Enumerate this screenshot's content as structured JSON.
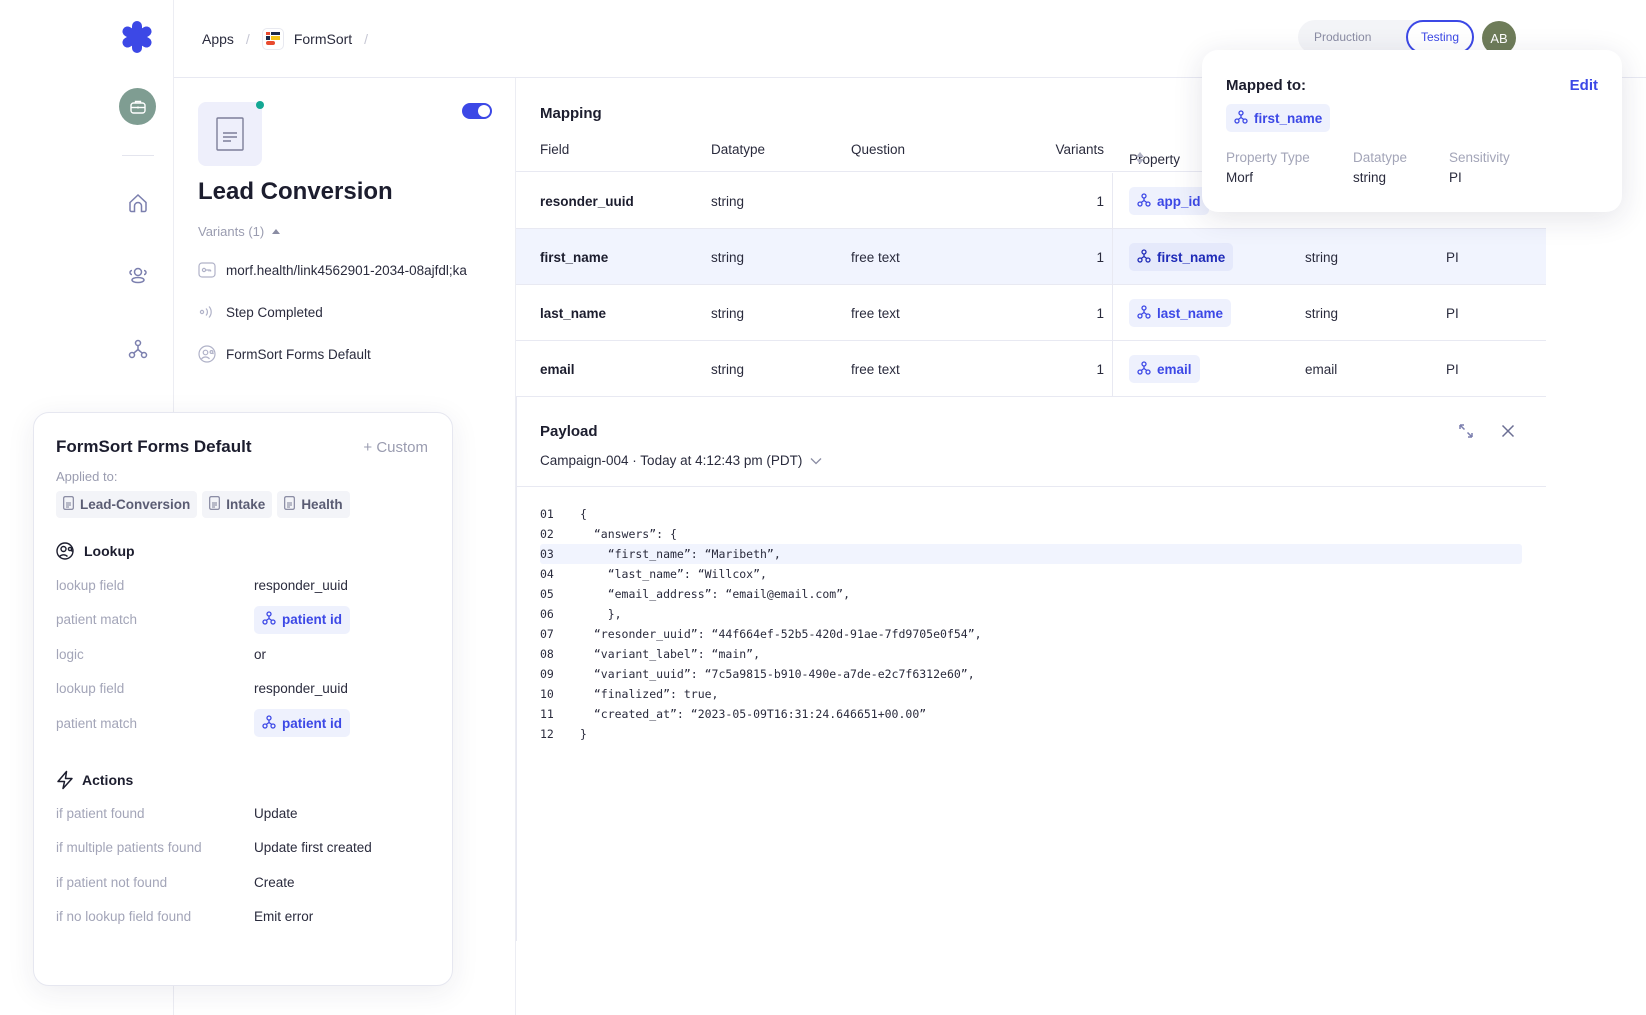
{
  "breadcrumb": {
    "apps": "Apps",
    "app": "FormSort"
  },
  "environment": {
    "options": [
      "Production",
      "Testing"
    ],
    "selected": "Testing"
  },
  "user": {
    "initials": "AB"
  },
  "form": {
    "title": "Lead Conversion",
    "variants_label": "Variants (1)",
    "link": "morf.health/link4562901-2034-08ajfdl;ka",
    "trigger": "Step Completed",
    "ruleset": "FormSort Forms Default",
    "enabled": true
  },
  "ruleset_card": {
    "title": "FormSort Forms Default",
    "custom_label": "+ Custom",
    "applied_label": "Applied to:",
    "applied_to": [
      "Lead-Conversion",
      "Intake",
      "Health"
    ],
    "lookup": {
      "heading": "Lookup",
      "rows": [
        {
          "key": "lookup field",
          "value": "responder_uuid",
          "type": "text"
        },
        {
          "key": "patient match",
          "value": "patient id",
          "type": "tag"
        },
        {
          "key": "logic",
          "value": "or",
          "type": "text"
        },
        {
          "key": "lookup field",
          "value": "responder_uuid",
          "type": "text"
        },
        {
          "key": "patient match",
          "value": "patient id",
          "type": "tag"
        }
      ]
    },
    "actions": {
      "heading": "Actions",
      "rows": [
        {
          "key": "if patient found",
          "value": "Update"
        },
        {
          "key": "if multiple patients found",
          "value": "Update first created"
        },
        {
          "key": "if patient not found",
          "value": "Create"
        },
        {
          "key": "if no lookup field found",
          "value": "Emit error"
        }
      ]
    }
  },
  "mapping": {
    "title": "Mapping",
    "columns": [
      "Field",
      "Datatype",
      "Question",
      "Variants",
      "Property"
    ],
    "rows": [
      {
        "field": "resonder_uuid",
        "datatype": "string",
        "question": "",
        "variants": "1",
        "property": "app_id",
        "prop_datatype": "",
        "sensitivity": ""
      },
      {
        "field": "first_name",
        "datatype": "string",
        "question": "free text",
        "variants": "1",
        "property": "first_name",
        "prop_datatype": "string",
        "sensitivity": "PI",
        "selected": true
      },
      {
        "field": "last_name",
        "datatype": "string",
        "question": "free text",
        "variants": "1",
        "property": "last_name",
        "prop_datatype": "string",
        "sensitivity": "PI"
      },
      {
        "field": "email",
        "datatype": "string",
        "question": "free text",
        "variants": "1",
        "property": "email",
        "prop_datatype": "email",
        "sensitivity": "PI"
      }
    ]
  },
  "popover": {
    "title": "Mapped to:",
    "edit_label": "Edit",
    "property": "first_name",
    "columns": [
      {
        "label": "Property Type",
        "value": "Morf"
      },
      {
        "label": "Datatype",
        "value": "string"
      },
      {
        "label": "Sensitivity",
        "value": "PI"
      }
    ]
  },
  "payload": {
    "title": "Payload",
    "event": "Campaign-004 · Today at 4:12:43 pm (PDT)",
    "highlighted_line": "03",
    "lines": [
      {
        "n": "01",
        "text": "{"
      },
      {
        "n": "02",
        "text": "  “answers”: {"
      },
      {
        "n": "03",
        "text": "    “first_name”: “Maribeth”,"
      },
      {
        "n": "04",
        "text": "    “last_name”: “Willcox”,"
      },
      {
        "n": "05",
        "text": "    “email_address”: “email@email.com”,"
      },
      {
        "n": "06",
        "text": "    },"
      },
      {
        "n": "07",
        "text": "  “resonder_uuid”: “44f664ef-52b5-420d-91ae-7fd9705e0f54”,"
      },
      {
        "n": "08",
        "text": "  “variant_label”: “main”,"
      },
      {
        "n": "09",
        "text": "  “variant_uuid”: “7c5a9815-b910-490e-a7de-e2c7f6312e60”,"
      },
      {
        "n": "10",
        "text": "  “finalized”: true,"
      },
      {
        "n": "11",
        "text": "  “created_at”: “2023-05-09T16:31:24.646651+00.00”"
      },
      {
        "n": "12",
        "text": "}"
      }
    ]
  },
  "colors": {
    "accent": "#3c48e6",
    "status_dot": "#14a894",
    "avatar": "#6e7c59",
    "brief": "#7f9d92"
  }
}
